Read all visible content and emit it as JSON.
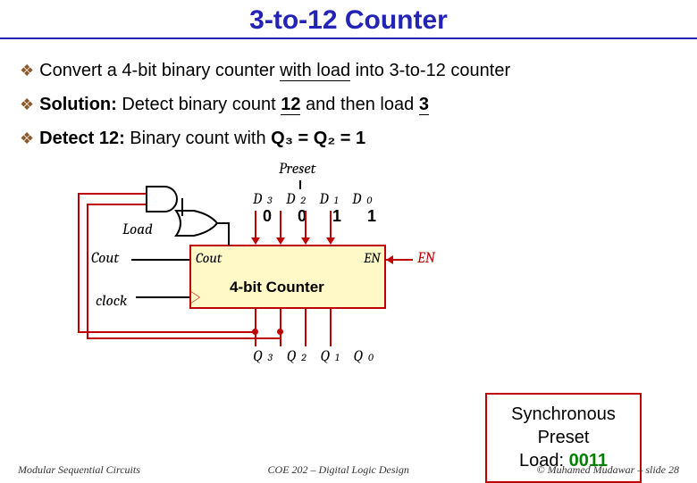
{
  "title": "3-to-12 Counter",
  "bullets": {
    "b1_pre": "Convert a 4-bit binary counter ",
    "b1_u": "with load",
    "b1_post": " into 3-to-12 counter",
    "b2_s": "Solution:",
    "b2_rest": " Detect binary count ",
    "b2_u1": "12",
    "b2_mid": " and then load ",
    "b2_u2": "3",
    "b3_s": "Detect 12:",
    "b3_rest": " Binary count with ",
    "b3_eq": "Q₃ = Q₂ = 1"
  },
  "labels": {
    "preset": "Preset",
    "load": "Load",
    "d3": "D",
    "d3s": "3",
    "d2": "D",
    "d2s": "2",
    "d1": "D",
    "d1s": "1",
    "d0": "D",
    "d0s": "0",
    "bits": "0 0 1 1",
    "counter": "4-bit Counter",
    "cout_in": "Cout",
    "en_in": "EN",
    "cout": "Cout",
    "en": "EN",
    "clock": "clock",
    "q3": "Q",
    "q3s": "3",
    "q2": "Q",
    "q2s": "2",
    "q1": "Q",
    "q1s": "1",
    "q0": "Q",
    "q0s": "0"
  },
  "info": {
    "l1": "Synchronous",
    "l2": "Preset",
    "l3a": "Load: ",
    "l3b": "0011"
  },
  "footer": {
    "left": "Modular Sequential Circuits",
    "center": "COE 202 – Digital Logic Design",
    "right": "© Muhamed Mudawar – slide 28"
  }
}
